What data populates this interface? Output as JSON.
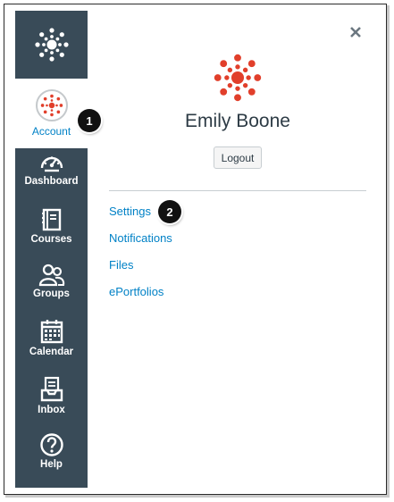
{
  "nav": {
    "account_label": "Account",
    "items": [
      {
        "label": "Dashboard",
        "icon": "dashboard-icon"
      },
      {
        "label": "Courses",
        "icon": "courses-icon"
      },
      {
        "label": "Groups",
        "icon": "groups-icon"
      },
      {
        "label": "Calendar",
        "icon": "calendar-icon"
      },
      {
        "label": "Inbox",
        "icon": "inbox-icon"
      },
      {
        "label": "Help",
        "icon": "help-icon"
      }
    ]
  },
  "tray": {
    "user_name": "Emily Boone",
    "logout_label": "Logout",
    "links": [
      "Settings",
      "Notifications",
      "Files",
      "ePortfolios"
    ]
  },
  "callouts": [
    "1",
    "2"
  ],
  "colors": {
    "nav_bg": "#394b58",
    "link": "#0081c6",
    "brand_red": "#e13f2b",
    "text_dark": "#2d3b45"
  }
}
